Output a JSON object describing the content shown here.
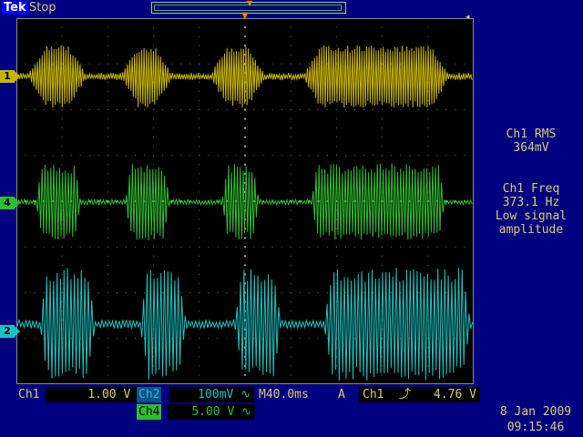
{
  "brand": "Tek",
  "acquisition_state": "Stop",
  "channels": [
    {
      "id": "ch1",
      "marker": "1",
      "color": "#c8b400"
    },
    {
      "id": "ch4",
      "marker": "4",
      "color": "#2ebd2e"
    },
    {
      "id": "ch2",
      "marker": "2",
      "color": "#19c4c4"
    }
  ],
  "measurements": [
    {
      "label": "Ch1 RMS",
      "value": "364mV",
      "note": ""
    },
    {
      "label": "Ch1 Freq",
      "value": "373.1 Hz",
      "note": "Low signal amplitude"
    }
  ],
  "status_bar": {
    "ch1_label": "Ch1",
    "ch1_scale": "1.00 V ∿",
    "ch2_label": "Ch2",
    "ch2_scale": "100mV ∿",
    "timebase": "M40.0ms",
    "trigger_mode": "A",
    "trigger_source": "Ch1",
    "trigger_slope": "⤴",
    "trigger_level": "4.76 V",
    "ch4_label": "Ch4",
    "ch4_scale": "5.00 V ∿"
  },
  "clock": {
    "date": "8 Jan  2009",
    "time": "09:15:46"
  },
  "icons": {
    "trigger_position": "trigger-position-icon",
    "trigger_level": "trigger-level-icon",
    "record_view": "record-view-icon"
  },
  "colors": {
    "background": "#000080",
    "screen": "#000000",
    "readout_text": "#d6d06a",
    "trigger_marker": "#ff7a00"
  }
}
